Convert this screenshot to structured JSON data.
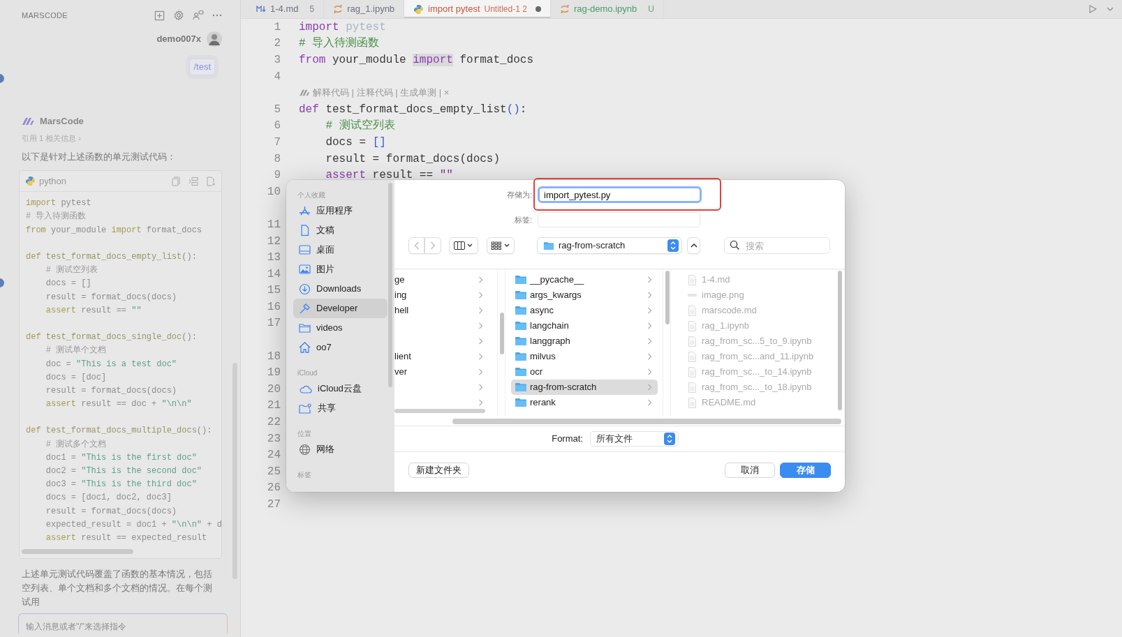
{
  "chat_panel": {
    "title": "MARSCODE",
    "user": {
      "name": "demo007x"
    },
    "user_message": {
      "text": "/test"
    },
    "assistant": {
      "name": "MarsCode"
    },
    "reference": "引用 1 相关信息 ›",
    "intro": "以下是针对上述函数的单元测试代码：",
    "code_block": {
      "language": "python",
      "lines": [
        {
          "kind": "code",
          "tokens": [
            {
              "kind": "keyword",
              "text": "import"
            },
            {
              "kind": "plain",
              "text": " pytest"
            }
          ]
        },
        {
          "kind": "code",
          "tokens": [
            {
              "kind": "comment",
              "text": "# 导入待测函数"
            }
          ]
        },
        {
          "kind": "code",
          "tokens": [
            {
              "kind": "keyword",
              "text": "from"
            },
            {
              "kind": "plain",
              "text": " your_module "
            },
            {
              "kind": "keyword",
              "text": "import"
            },
            {
              "kind": "plain",
              "text": " format_docs"
            }
          ]
        },
        {
          "kind": "blank"
        },
        {
          "kind": "code",
          "tokens": [
            {
              "kind": "keyword",
              "text": "def"
            },
            {
              "kind": "function",
              "text": " test_format_docs_empty_list"
            },
            {
              "kind": "plain",
              "text": "():"
            }
          ]
        },
        {
          "kind": "code",
          "tokens": [
            {
              "kind": "comment",
              "text": "    # 测试空列表"
            }
          ]
        },
        {
          "kind": "code",
          "tokens": [
            {
              "kind": "plain",
              "text": "    docs = []"
            }
          ]
        },
        {
          "kind": "code",
          "tokens": [
            {
              "kind": "plain",
              "text": "    result = format_docs(docs)"
            }
          ]
        },
        {
          "kind": "code",
          "tokens": [
            {
              "kind": "keyword",
              "text": "    assert"
            },
            {
              "kind": "plain",
              "text": " result == "
            },
            {
              "kind": "string",
              "text": "\"\""
            }
          ]
        },
        {
          "kind": "blank"
        },
        {
          "kind": "code",
          "tokens": [
            {
              "kind": "keyword",
              "text": "def"
            },
            {
              "kind": "function",
              "text": " test_format_docs_single_doc"
            },
            {
              "kind": "plain",
              "text": "():"
            }
          ]
        },
        {
          "kind": "code",
          "tokens": [
            {
              "kind": "comment",
              "text": "    # 测试单个文档"
            }
          ]
        },
        {
          "kind": "code",
          "tokens": [
            {
              "kind": "plain",
              "text": "    doc = "
            },
            {
              "kind": "string",
              "text": "\"This is a test doc\""
            }
          ]
        },
        {
          "kind": "code",
          "tokens": [
            {
              "kind": "plain",
              "text": "    docs = [doc]"
            }
          ]
        },
        {
          "kind": "code",
          "tokens": [
            {
              "kind": "plain",
              "text": "    result = format_docs(docs)"
            }
          ]
        },
        {
          "kind": "code",
          "tokens": [
            {
              "kind": "keyword",
              "text": "    assert"
            },
            {
              "kind": "plain",
              "text": " result == doc + "
            },
            {
              "kind": "string",
              "text": "\"\\n\\n\""
            }
          ]
        },
        {
          "kind": "blank"
        },
        {
          "kind": "code",
          "tokens": [
            {
              "kind": "keyword",
              "text": "def"
            },
            {
              "kind": "function",
              "text": " test_format_docs_multiple_docs"
            },
            {
              "kind": "plain",
              "text": "():"
            }
          ]
        },
        {
          "kind": "code",
          "tokens": [
            {
              "kind": "comment",
              "text": "    # 测试多个文档"
            }
          ]
        },
        {
          "kind": "code",
          "tokens": [
            {
              "kind": "plain",
              "text": "    doc1 = "
            },
            {
              "kind": "string",
              "text": "\"This is the first doc\""
            }
          ]
        },
        {
          "kind": "code",
          "tokens": [
            {
              "kind": "plain",
              "text": "    doc2 = "
            },
            {
              "kind": "string",
              "text": "\"This is the second doc\""
            }
          ]
        },
        {
          "kind": "code",
          "tokens": [
            {
              "kind": "plain",
              "text": "    doc3 = "
            },
            {
              "kind": "string",
              "text": "\"This is the third doc\""
            }
          ]
        },
        {
          "kind": "code",
          "tokens": [
            {
              "kind": "plain",
              "text": "    docs = [doc1, doc2, doc3]"
            }
          ]
        },
        {
          "kind": "code",
          "tokens": [
            {
              "kind": "plain",
              "text": "    result = format_docs(docs)"
            }
          ]
        },
        {
          "kind": "code",
          "tokens": [
            {
              "kind": "plain",
              "text": "    expected_result = doc1 + "
            },
            {
              "kind": "string",
              "text": "\"\\n\\n\""
            },
            {
              "kind": "plain",
              "text": " + d"
            }
          ]
        },
        {
          "kind": "code",
          "tokens": [
            {
              "kind": "keyword",
              "text": "    assert"
            },
            {
              "kind": "plain",
              "text": " result == expected_result"
            }
          ]
        }
      ]
    },
    "summary": "上述单元测试代码覆盖了函数的基本情况，包括空列表、单个文档和多个文档的情况。在每个测试用",
    "input": {
      "placeholder": "输入消息或者\"/\"来选择指令"
    }
  },
  "tabs": [
    {
      "label": "1-4.md",
      "badge": "5",
      "kind": "markdown",
      "color": "#6b7280",
      "selected": false,
      "modified": false
    },
    {
      "label": "rag_1.ipynb",
      "kind": "notebook",
      "color": "#6b7280",
      "selected": false,
      "modified": false
    },
    {
      "label": "import pytest",
      "detail": "Untitled-1 2",
      "kind": "python",
      "color": "#c8553d",
      "selected": true,
      "modified": true
    },
    {
      "label": "rag-demo.ipynb",
      "badge": "U",
      "kind": "notebook",
      "color": "#4a9a6a",
      "selected": false,
      "modified": false
    }
  ],
  "editor": {
    "lines": [
      {
        "number": "1",
        "kind": "code",
        "tokens": [
          {
            "kind": "keyword",
            "text": "import"
          },
          {
            "kind": "unused",
            "text": " pytest"
          }
        ]
      },
      {
        "number": "2",
        "kind": "code",
        "tokens": [
          {
            "kind": "comment",
            "text": "# 导入待测函数"
          }
        ]
      },
      {
        "number": "3",
        "kind": "code",
        "tokens": [
          {
            "kind": "keyword",
            "text": "from"
          },
          {
            "kind": "plain",
            "text": " your_module "
          },
          {
            "kind": "keyword-highlight",
            "text": "import"
          },
          {
            "kind": "plain",
            "text": " format_docs"
          }
        ]
      },
      {
        "number": "4",
        "kind": "blank"
      },
      {
        "kind": "lens",
        "text": "解释代码 | 注释代码 | 生成单测 | ×"
      },
      {
        "number": "5",
        "kind": "code",
        "tokens": [
          {
            "kind": "keyword",
            "text": "def"
          },
          {
            "kind": "plain",
            "text": " test_format_docs_empty_list"
          },
          {
            "kind": "bracket",
            "text": "()"
          },
          {
            "kind": "plain",
            "text": ":"
          }
        ]
      },
      {
        "number": "6",
        "kind": "code",
        "tokens": [
          {
            "kind": "comment",
            "text": "    # 测试空列表"
          }
        ]
      },
      {
        "number": "7",
        "kind": "code",
        "tokens": [
          {
            "kind": "plain",
            "text": "    docs = "
          },
          {
            "kind": "bracket",
            "text": "[]"
          }
        ]
      },
      {
        "number": "8",
        "kind": "code",
        "tokens": [
          {
            "kind": "plain",
            "text": "    result = format_docs(docs)"
          }
        ]
      },
      {
        "number": "9",
        "kind": "code",
        "tokens": [
          {
            "kind": "keyword",
            "text": "    assert"
          },
          {
            "kind": "plain",
            "text": " result == "
          },
          {
            "kind": "string",
            "text": "\"\""
          }
        ]
      },
      {
        "number": "10",
        "kind": "covered"
      },
      {
        "kind": "lens"
      },
      {
        "number": "11",
        "kind": "covered"
      },
      {
        "number": "12",
        "kind": "covered"
      },
      {
        "number": "13",
        "kind": "covered"
      },
      {
        "number": "14",
        "kind": "covered"
      },
      {
        "number": "15",
        "kind": "covered"
      },
      {
        "number": "16",
        "kind": "covered"
      },
      {
        "number": "17",
        "kind": "covered"
      },
      {
        "kind": "lens"
      },
      {
        "number": "18",
        "kind": "covered"
      },
      {
        "number": "19",
        "kind": "covered"
      },
      {
        "number": "20",
        "kind": "covered"
      },
      {
        "number": "21",
        "kind": "covered"
      },
      {
        "number": "22",
        "kind": "covered"
      },
      {
        "number": "23",
        "kind": "covered"
      },
      {
        "number": "24",
        "kind": "covered"
      },
      {
        "number": "25",
        "kind": "covered"
      },
      {
        "number": "26",
        "kind": "covered"
      },
      {
        "number": "27",
        "kind": "covered"
      }
    ]
  },
  "save_dialog": {
    "sidebar": [
      {
        "heading": "个人收藏",
        "items": [
          {
            "label": "应用程序",
            "selected": false
          },
          {
            "label": "文稿",
            "selected": false
          },
          {
            "label": "桌面",
            "selected": false
          },
          {
            "label": "图片",
            "selected": false
          },
          {
            "label": "Downloads",
            "selected": false
          },
          {
            "label": "Developer",
            "selected": true
          },
          {
            "label": "videos",
            "selected": false
          },
          {
            "label": "oo7",
            "selected": false
          }
        ]
      },
      {
        "heading": "iCloud",
        "items": [
          {
            "label": "iCloud云盘",
            "selected": false
          },
          {
            "label": "共享",
            "selected": false
          }
        ]
      },
      {
        "heading": "位置",
        "items": [
          {
            "label": "网络",
            "selected": false
          }
        ]
      },
      {
        "heading": "标签"
      }
    ],
    "save_as": {
      "label": "存储为:",
      "value": "import_pytest.py"
    },
    "tags": {
      "label": "标签:"
    },
    "location": "rag-from-scratch",
    "search": {
      "placeholder": "搜索"
    },
    "parent_column": [
      {
        "text": "ge",
        "selected": false
      },
      {
        "text": "ing",
        "selected": false
      },
      {
        "text": "hell",
        "selected": false
      },
      {
        "selected": false
      },
      {
        "selected": false
      },
      {
        "text": "lient",
        "selected": false
      },
      {
        "text": "ver",
        "selected": false
      },
      {
        "selected": false
      },
      {
        "selected": false
      }
    ],
    "folder_column": [
      {
        "text": "__pycache__",
        "selected": false
      },
      {
        "text": "args_kwargs",
        "selected": false
      },
      {
        "text": "async",
        "selected": false
      },
      {
        "text": "langchain",
        "selected": false
      },
      {
        "text": "langgraph",
        "selected": false
      },
      {
        "text": "milvus",
        "selected": false
      },
      {
        "text": "ocr",
        "selected": false
      },
      {
        "text": "rag-from-scratch",
        "selected": true
      },
      {
        "text": "rerank",
        "selected": false
      }
    ],
    "file_column": [
      {
        "text": "1-4.md",
        "kind": "document",
        "disabled": true
      },
      {
        "text": "image.png",
        "kind": "image",
        "disabled": true
      },
      {
        "text": "marscode.md",
        "kind": "document",
        "disabled": true
      },
      {
        "text": "rag_1.ipynb",
        "kind": "document",
        "disabled": true
      },
      {
        "text": "rag_from_sc...5_to_9.ipynb",
        "kind": "document",
        "disabled": true
      },
      {
        "text": "rag_from_sc...and_11.ipynb",
        "kind": "document",
        "disabled": true
      },
      {
        "text": "rag_from_sc..._to_14.ipynb",
        "kind": "document",
        "disabled": true
      },
      {
        "text": "rag_from_sc..._to_18.ipynb",
        "kind": "document",
        "disabled": true
      },
      {
        "text": "README.md",
        "kind": "document",
        "disabled": true
      }
    ],
    "format": {
      "label": "Format:",
      "value": "所有文件"
    },
    "buttons": [
      {
        "label": "新建文件夹",
        "kind": "secondary"
      },
      {
        "label": "取消",
        "kind": "secondary"
      },
      {
        "label": "存储",
        "kind": "primary"
      }
    ]
  }
}
